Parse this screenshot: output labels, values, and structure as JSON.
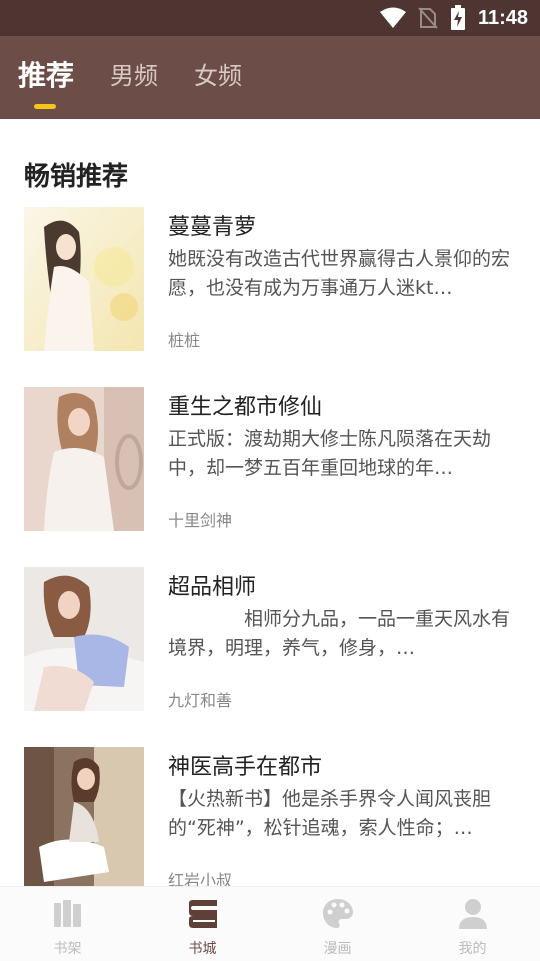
{
  "status_bar": {
    "time": "11:48",
    "icons": [
      "wifi-icon",
      "no-sim-icon",
      "battery-charging-icon"
    ]
  },
  "header": {
    "tabs": [
      {
        "label": "推荐",
        "active": true
      },
      {
        "label": "男频",
        "active": false
      },
      {
        "label": "女频",
        "active": false
      }
    ],
    "indicator_color": "#f5c518",
    "background": "#6d4d48"
  },
  "section": {
    "title": "畅销推荐"
  },
  "books": [
    {
      "title": "蔓蔓青萝",
      "description": "她既没有改造古代世界赢得古人景仰的宏愿，也没有成为万事通万人迷kt…",
      "author": "桩桩",
      "cover": "illustrated-girl-cover"
    },
    {
      "title": "重生之都市修仙",
      "description": "正式版：渡劫期大修士陈凡陨落在天劫中，却一梦五百年重回地球的年…",
      "author": "十里剑神",
      "cover": "photo-girl-white-dress-cover"
    },
    {
      "title": "超品相师",
      "description": "　　　　相师分九品，一品一重天风水有境界，明理，养气，修身，…",
      "author": "九灯和善",
      "cover": "photo-girl-blue-top-cover"
    },
    {
      "title": "神医高手在都市",
      "description": "【火热新书】他是杀手界令人闻风丧胆的“死神”，松针追魂，索人性命；…",
      "author": "红岩小叔",
      "cover": "photo-girl-white-socks-cover"
    }
  ],
  "bottom_nav": {
    "items": [
      {
        "label": "书架",
        "icon": "bookshelf-icon",
        "active": false
      },
      {
        "label": "书城",
        "icon": "bookstore-icon",
        "active": true
      },
      {
        "label": "漫画",
        "icon": "palette-icon",
        "active": false
      },
      {
        "label": "我的",
        "icon": "user-icon",
        "active": false
      }
    ]
  }
}
